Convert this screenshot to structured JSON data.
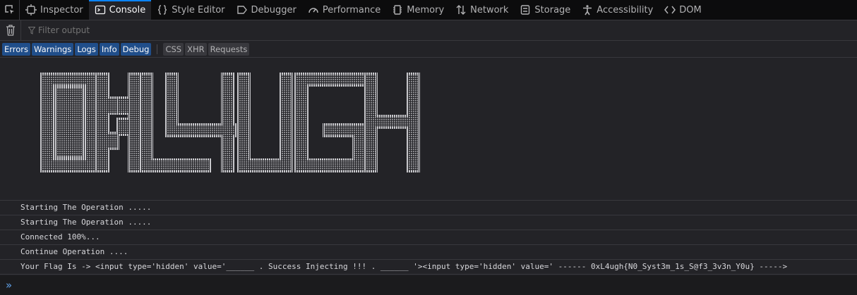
{
  "tabs": [
    {
      "label": "Inspector",
      "icon": "inspector-icon"
    },
    {
      "label": "Console",
      "icon": "console-icon",
      "selected": true
    },
    {
      "label": "Style Editor",
      "icon": "braces-icon"
    },
    {
      "label": "Debugger",
      "icon": "debugger-icon"
    },
    {
      "label": "Performance",
      "icon": "gauge-icon"
    },
    {
      "label": "Memory",
      "icon": "chip-icon"
    },
    {
      "label": "Network",
      "icon": "arrows-updown-icon"
    },
    {
      "label": "Storage",
      "icon": "storage-icon"
    },
    {
      "label": "Accessibility",
      "icon": "person-icon"
    },
    {
      "label": "DOM",
      "icon": "code-icon"
    }
  ],
  "filter": {
    "placeholder": "Filter output"
  },
  "levels": [
    "Errors",
    "Warnings",
    "Logs",
    "Info",
    "Debug"
  ],
  "extra_filters": [
    "CSS",
    "XHR",
    "Requests"
  ],
  "ascii_art_text": "0XL4UGH",
  "messages": [
    "Starting The Operation .....",
    "Starting The Operation .....",
    "Connected 100%...",
    "Continue Operation ....",
    "Your Flag Is -> <input type='hidden' value='______ . Success Injecting !!! . ______ '><input type='hidden' value=' ------ 0xL4ugh{N0_Syst3m_1s_S@f3_3v3n_Y0u} ----->"
  ],
  "prompt": "»",
  "colors": {
    "accent": "#0a84ff",
    "level_on": "#204e8a",
    "background": "#232327"
  }
}
